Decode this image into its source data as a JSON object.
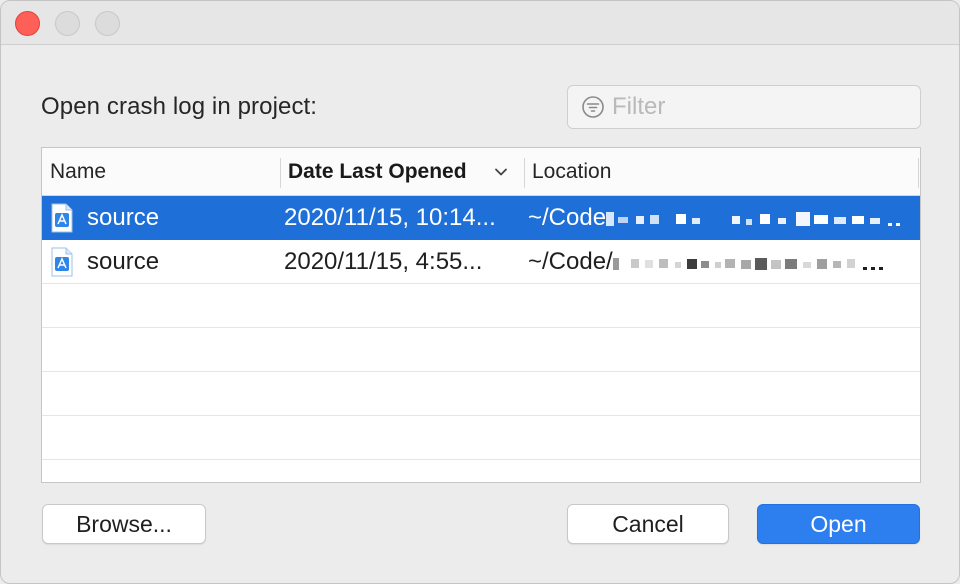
{
  "dialog": {
    "prompt": "Open crash log in project:"
  },
  "filter": {
    "placeholder": "Filter",
    "value": ""
  },
  "table": {
    "columns": {
      "name": "Name",
      "date": "Date Last Opened",
      "location": "Location"
    },
    "sort": {
      "column": "date",
      "direction": "descending"
    },
    "rows": [
      {
        "name": "source",
        "date": "2020/11/15, 10:14...",
        "location": "~/Code",
        "location_tail": "...",
        "selected": true,
        "icon": "xcode-project-icon"
      },
      {
        "name": "source",
        "date": "2020/11/15, 4:55...",
        "location": "~/Code/",
        "location_tail": "...",
        "selected": false,
        "icon": "xcode-project-icon"
      }
    ]
  },
  "buttons": {
    "browse": "Browse...",
    "cancel": "Cancel",
    "open": "Open"
  },
  "colors": {
    "accent": "#1e6fd8",
    "close": "#fe5f57",
    "default_button": "#2d7ff0"
  }
}
